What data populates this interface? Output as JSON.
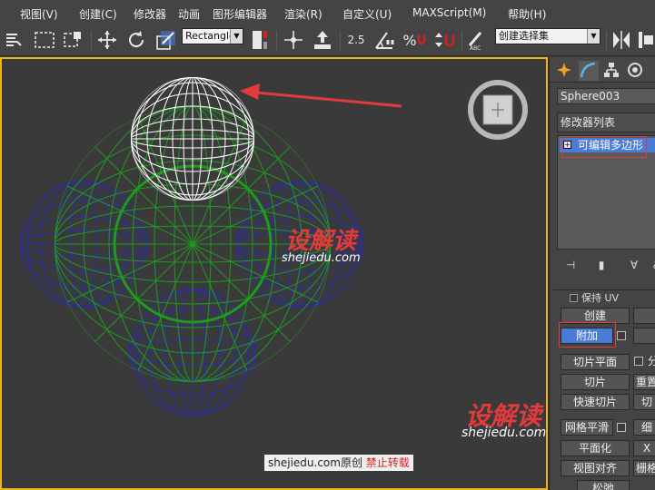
{
  "menu": {
    "items": [
      "视图(V)",
      "创建(C)",
      "修改器",
      "动画",
      "图形编辑器",
      "渲染(R)",
      "自定义(U)",
      "MAXScript(M)",
      "帮助(H)"
    ]
  },
  "toolbar": {
    "selection_region": "Rectangle",
    "angle_snap_value": "2.5",
    "named_selection": "创建选择集",
    "percent_symbol": "%"
  },
  "panel": {
    "object_name": "Sphere003",
    "modifier_list": "修改器列表",
    "stack_item": "可编辑多边形",
    "rollout": {
      "preserve_uv": "保持 UV",
      "create": "创建",
      "attach": "附加",
      "slice_plane": "切片平面",
      "split_partial": "分",
      "slice": "切片",
      "reset_partial": "重置",
      "quickslice": "快速切片",
      "cut_partial": "切",
      "meshsmooth": "网格平滑",
      "tessellate_partial": "细",
      "make_planar": "平面化",
      "x_label": "X",
      "view_align": "视图对齐",
      "grid_align_partial": "栅格",
      "relax_partial": "松弛"
    }
  },
  "watermark": {
    "logo_main": "设解读",
    "url": "shejiedu.com",
    "credit_prefix": "shejiedu.com原创",
    "credit_warning": "禁止转载"
  },
  "colors": {
    "selected_wire": "#ffffff",
    "green_wire": "#1f9a1f",
    "blue_wire": "#2a2ab0",
    "viewport_border": "#f2b416",
    "arrow_red": "#e23b3b",
    "accent_blue": "#4a7bd6"
  }
}
